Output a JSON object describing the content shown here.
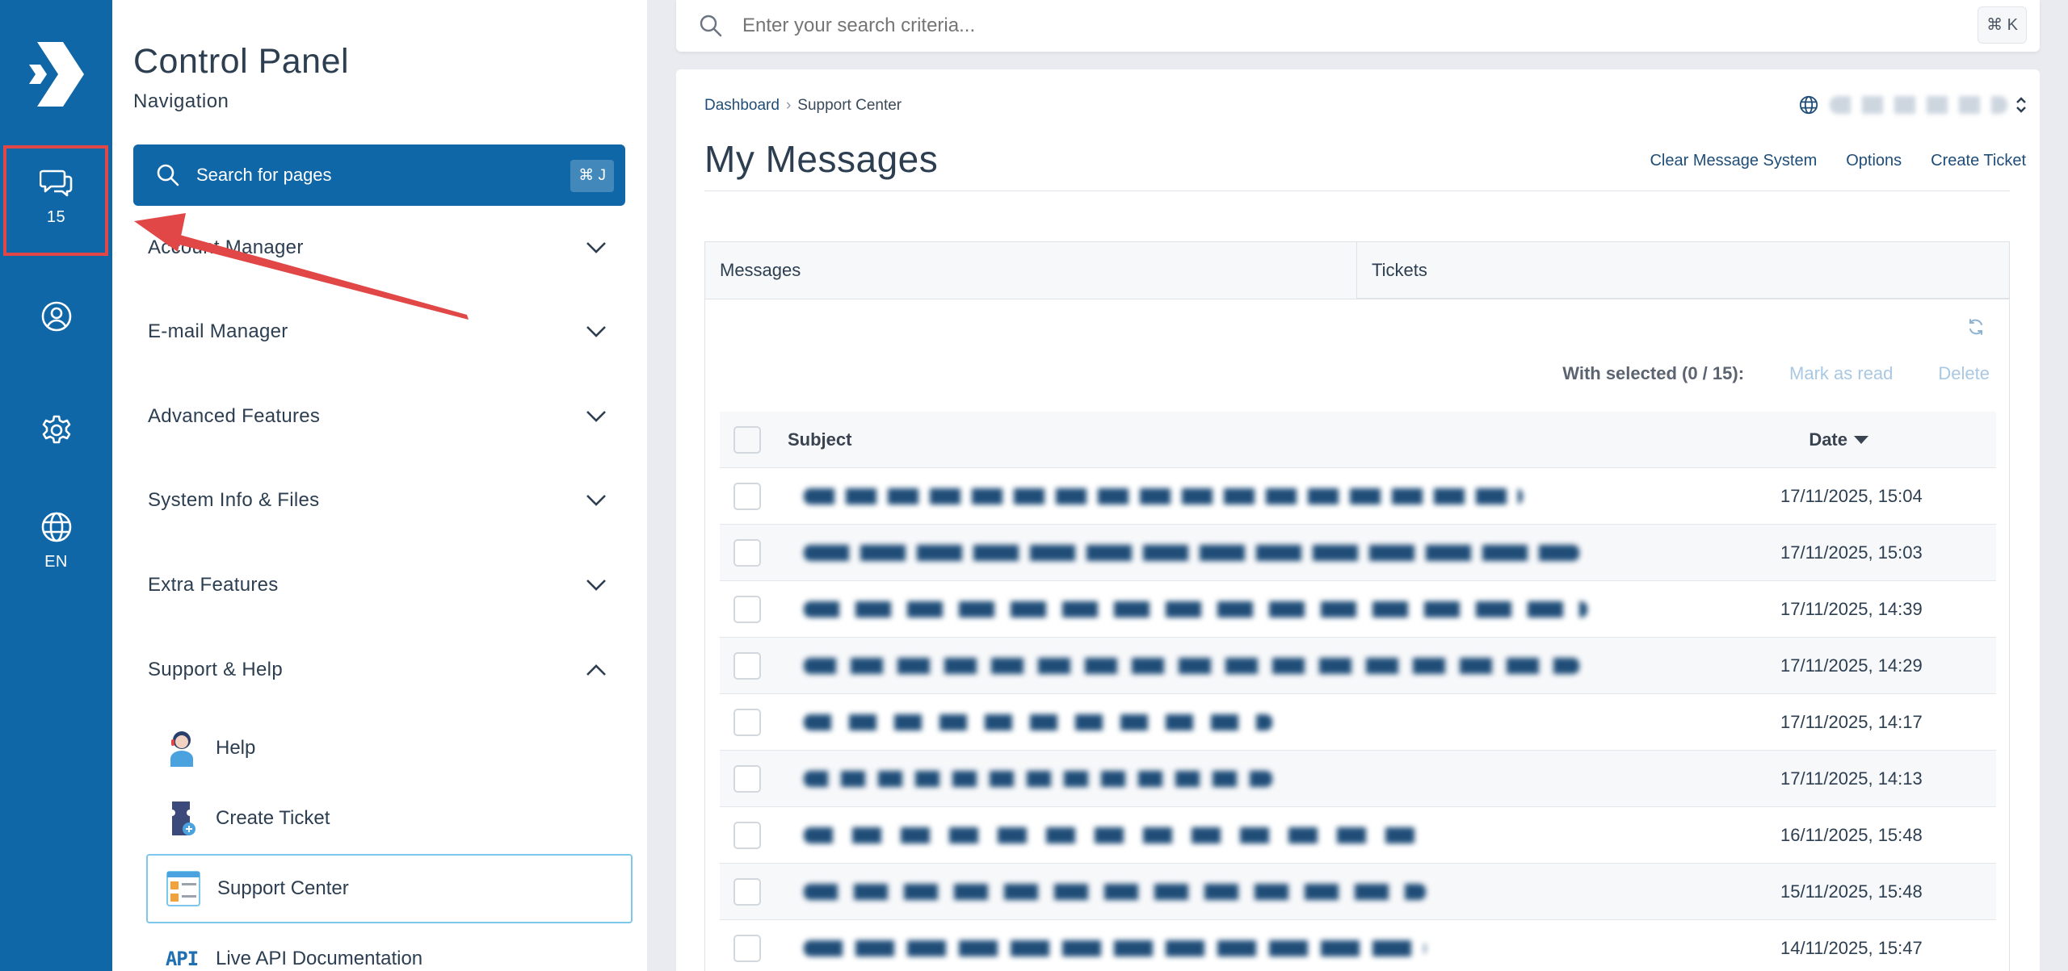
{
  "rail": {
    "messages_count": "15",
    "language": "EN"
  },
  "nav": {
    "title": "Control Panel",
    "subtitle": "Navigation",
    "search_label": "Search for pages",
    "search_shortcut": "⌘ J",
    "groups": [
      {
        "label": "Account Manager"
      },
      {
        "label": "E-mail Manager"
      },
      {
        "label": "Advanced Features"
      },
      {
        "label": "System Info & Files"
      },
      {
        "label": "Extra Features"
      },
      {
        "label": "Support & Help"
      }
    ],
    "support_items": [
      {
        "label": "Help",
        "icon": "help-agent-icon"
      },
      {
        "label": "Create Ticket",
        "icon": "ticket-icon"
      },
      {
        "label": "Support Center",
        "icon": "support-center-icon"
      },
      {
        "label": "Live API Documentation",
        "icon": "api-icon",
        "badge": "API"
      }
    ]
  },
  "top_search": {
    "placeholder": "Enter your search criteria...",
    "shortcut": "⌘ K"
  },
  "breadcrumb": {
    "items": [
      "Dashboard",
      "Support Center"
    ]
  },
  "page": {
    "title": "My Messages",
    "actions": [
      "Clear Message System",
      "Options",
      "Create Ticket"
    ]
  },
  "tabs": [
    "Messages",
    "Tickets"
  ],
  "bulk": {
    "label": "With selected (0 / 15):",
    "mark_read": "Mark as read",
    "delete": "Delete"
  },
  "table": {
    "columns": {
      "subject": "Subject",
      "date": "Date"
    },
    "rows": [
      {
        "date": "17/11/2025, 15:04"
      },
      {
        "date": "17/11/2025, 15:03"
      },
      {
        "date": "17/11/2025, 14:39"
      },
      {
        "date": "17/11/2025, 14:29"
      },
      {
        "date": "17/11/2025, 14:17"
      },
      {
        "date": "17/11/2025, 14:13"
      },
      {
        "date": "16/11/2025, 15:48"
      },
      {
        "date": "15/11/2025, 15:48"
      },
      {
        "date": "14/11/2025, 15:47"
      }
    ]
  },
  "colors": {
    "brand": "#0f67a8",
    "highlight": "#e24747",
    "link": "#1f4d78",
    "muted_action": "#a9c8e3"
  }
}
